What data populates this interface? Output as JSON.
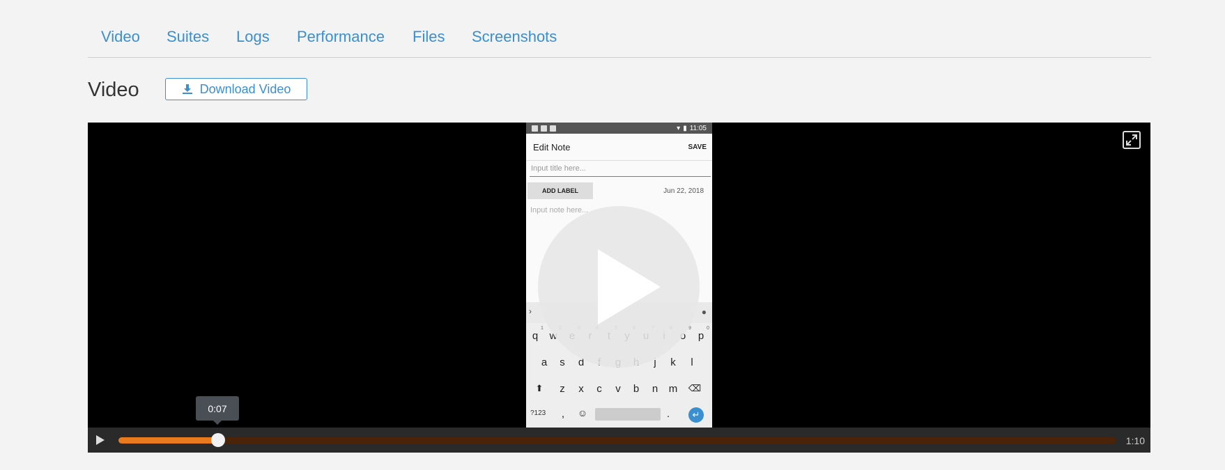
{
  "tabs": [
    "Video",
    "Suites",
    "Logs",
    "Performance",
    "Files",
    "Screenshots"
  ],
  "section_title": "Video",
  "download_button": "Download Video",
  "phone": {
    "status_time": "11:05",
    "app_title": "Edit Note",
    "save_label": "SAVE",
    "title_placeholder": "Input title here...",
    "add_label": "ADD LABEL",
    "date": "Jun 22, 2018",
    "note_placeholder": "Input note here...",
    "keyboard": {
      "row1": [
        "q",
        "w",
        "e",
        "r",
        "t",
        "y",
        "u",
        "i",
        "o",
        "p"
      ],
      "row1_hints": [
        "1",
        "2",
        "3",
        "4",
        "5",
        "6",
        "7",
        "8",
        "9",
        "0"
      ],
      "row2": [
        "a",
        "s",
        "d",
        "f",
        "g",
        "h",
        "j",
        "k",
        "l"
      ],
      "row3": [
        "z",
        "x",
        "c",
        "v",
        "b",
        "n",
        "m"
      ],
      "symbols": "?123",
      "comma": ",",
      "period": "."
    }
  },
  "player": {
    "current_time": "0:07",
    "duration": "1:10",
    "progress_fraction": 0.1
  },
  "colors": {
    "accent": "#3a8fd0",
    "progress": "#e87b1e",
    "progress_track": "#4a2308"
  }
}
